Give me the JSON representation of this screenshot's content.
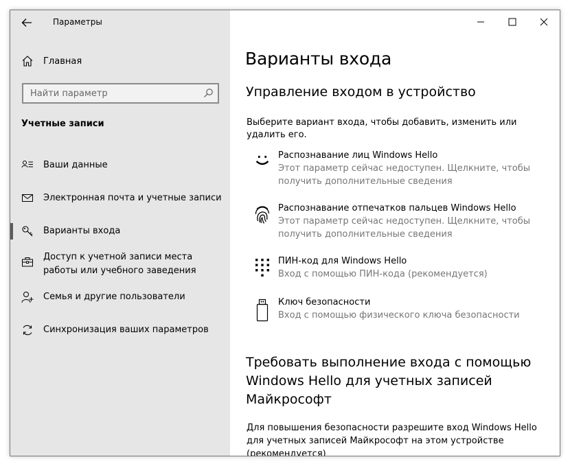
{
  "window": {
    "title": "Параметры",
    "controls": {
      "minimize": "minimize-icon",
      "maximize": "maximize-icon",
      "close": "close-icon"
    }
  },
  "sidebar": {
    "home_label": "Главная",
    "search_placeholder": "Найти параметр",
    "section_title": "Учетные записи",
    "items": [
      {
        "label": "Ваши данные",
        "icon": "user-card-icon"
      },
      {
        "label": "Электронная почта и учетные записи",
        "icon": "mail-icon"
      },
      {
        "label": "Варианты входа",
        "icon": "key-icon",
        "selected": true
      },
      {
        "label": "Доступ к учетной записи места работы или учебного заведения",
        "icon": "briefcase-icon"
      },
      {
        "label": "Семья и другие пользователи",
        "icon": "add-user-icon"
      },
      {
        "label": "Синхронизация ваших параметров",
        "icon": "sync-icon"
      }
    ]
  },
  "main": {
    "title": "Варианты входа",
    "subtitle": "Управление входом в устройство",
    "description": "Выберите вариант входа, чтобы добавить, изменить или удалить его.",
    "options": [
      {
        "title": "Распознавание лиц Windows Hello",
        "desc": "Этот параметр сейчас недоступен. Щелкните, чтобы получить дополнительные сведения",
        "icon": "face-icon"
      },
      {
        "title": "Распознавание отпечатков пальцев Windows Hello",
        "desc": "Этот параметр сейчас недоступен. Щелкните, чтобы получить дополнительные сведения",
        "icon": "fingerprint-icon"
      },
      {
        "title": "ПИН-код для Windows Hello",
        "desc": "Вход с помощью ПИН-кода (рекомендуется)",
        "icon": "pin-keypad-icon"
      },
      {
        "title": "Ключ безопасности",
        "desc": "Вход с помощью физического ключа безопасности",
        "icon": "usb-key-icon"
      }
    ],
    "section2_title": "Требовать выполнение входа с помощью Windows Hello для учетных записей Майкрософт",
    "section2_desc": "Для повышения безопасности разрешите вход Windows Hello для учетных записей Майкрософт на этом устройстве (рекомендуется)"
  },
  "colors": {
    "sidebar_bg": "#e6e6e6",
    "main_bg": "#ffffff",
    "secondary_text": "#767676",
    "selected_marker": "#5c5c5c"
  }
}
